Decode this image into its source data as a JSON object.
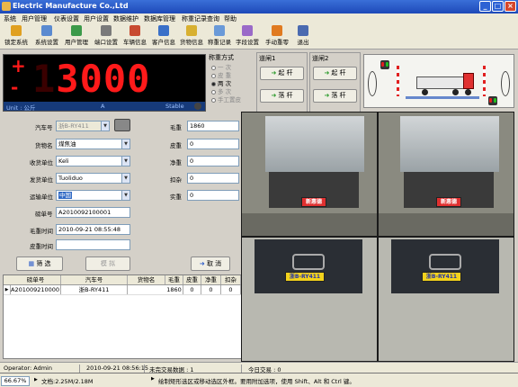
{
  "window": {
    "title": "Electric Manufacture Co.,Ltd"
  },
  "menu": [
    "系统",
    "用户管理",
    "仪表设置",
    "用户设置",
    "数据维护",
    "数据库管理",
    "称重记录查询",
    "帮助"
  ],
  "toolbar": [
    "锁定系统",
    "系统设置",
    "用户管理",
    "端口设置",
    "车辆信息",
    "客户信息",
    "货物信息",
    "称重记录",
    "字段设置",
    "手动重零",
    "退出"
  ],
  "display": {
    "sign": "+",
    "sign2": "-",
    "digits_dim": "1",
    "digits": "3000",
    "unit": "Unit : 公斤",
    "a_label": "A",
    "stable_label": "Stable"
  },
  "weigh_mode": {
    "title": "称重方式",
    "options": [
      {
        "label": "一 次",
        "selected": false
      },
      {
        "label": "皮 重",
        "selected": false
      },
      {
        "label": "两 次",
        "selected": true
      },
      {
        "label": "多 次",
        "selected": false
      },
      {
        "label": "手工置皮",
        "selected": false
      }
    ]
  },
  "gate1": {
    "title": "道闸1",
    "raise": "起 杆",
    "lower": "落 杆"
  },
  "gate2": {
    "title": "道闸2",
    "raise": "起 杆",
    "lower": "落 杆"
  },
  "form": {
    "plate_label": "汽车号",
    "plate_value": "浙B-RY411",
    "cargo_label": "货物名",
    "cargo_value": "煤焦油",
    "receiver_label": "收货单位",
    "receiver_value": "Keli",
    "sender_label": "发货单位",
    "sender_value": "Tuoliduo",
    "transport_label": "运输单位",
    "transport_value": "中国",
    "bill_label": "磅单号",
    "bill_value": "A2010092100001",
    "gross_time_label": "毛重时间",
    "gross_time_value": "2010-09-21 08:55:48",
    "tare_time_label": "皮重时间",
    "tare_time_value": "",
    "gross_label": "毛重",
    "gross_value": "1860",
    "tare_label": "皮重",
    "tare_value": "0",
    "net_label": "净重",
    "net_value": "0",
    "deduct_label": "扣杂",
    "deduct_value": "0",
    "actual_label": "实重",
    "actual_value": "0"
  },
  "buttons": {
    "filter": "筛 选",
    "simulate": "模 拟",
    "cancel": "取 消"
  },
  "table": {
    "columns": [
      "磅单号",
      "汽车号",
      "货物名",
      "毛重",
      "皮重",
      "净重",
      "扣杂"
    ],
    "rows": [
      [
        "A2010092100001",
        "浙B-RY411",
        "",
        "1860",
        "0",
        "0",
        "0"
      ]
    ]
  },
  "cameras": {
    "plate_top": "新惠德",
    "plate_bottom": "浙B-RY411"
  },
  "status": {
    "operator": "Operator: Admin",
    "datetime": "2010-09-21 08:56:15",
    "pending": "未完交易数据 : 1",
    "today": "今日交易 : 0"
  },
  "editor": {
    "zoom": "66.67%",
    "doc": "文档:2.25M/2.18M",
    "hint": "绘制矩形选区或移动选区外框。要用附加选项，使用 Shift、Alt 和 Ctrl 键。"
  },
  "colors": {
    "title_bar": "#1d49b8",
    "digit_red": "#ff1a1a",
    "plate_yellow": "#f2d21c"
  }
}
